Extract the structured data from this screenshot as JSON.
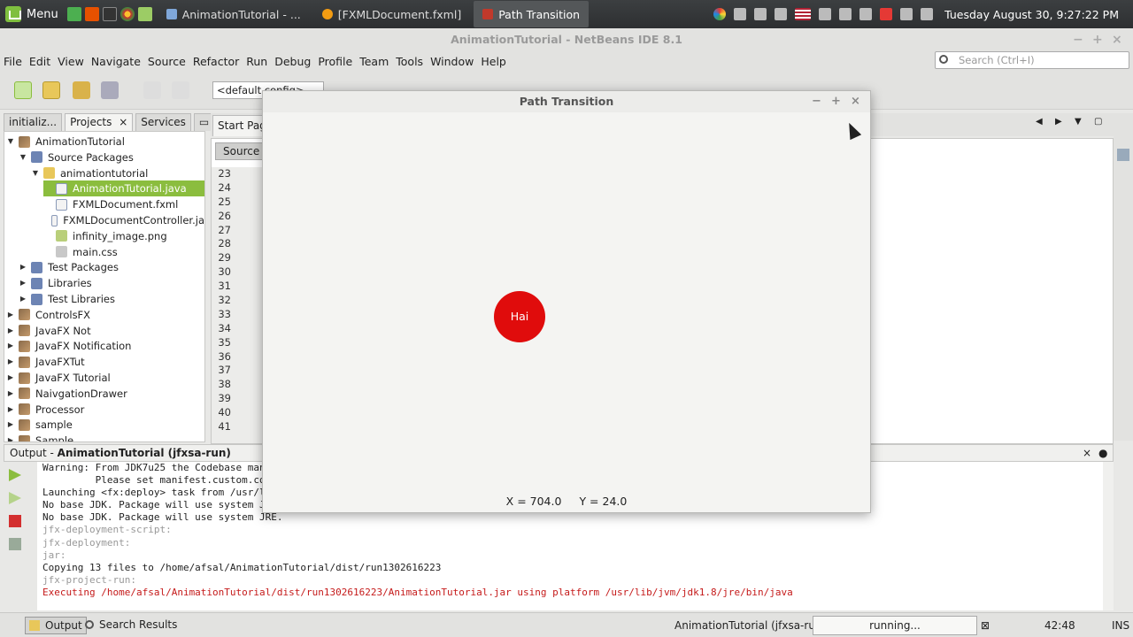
{
  "taskbar": {
    "menu_label": "Menu",
    "tasks": [
      {
        "label": "AnimationTutorial - ..."
      },
      {
        "label": "[FXMLDocument.fxml]"
      },
      {
        "label": "Path Transition"
      }
    ],
    "clock": "Tuesday August 30,  9:27:22 PM"
  },
  "ide": {
    "title": "AnimationTutorial - NetBeans IDE 8.1",
    "menu": [
      "File",
      "Edit",
      "View",
      "Navigate",
      "Source",
      "Refactor",
      "Run",
      "Debug",
      "Profile",
      "Team",
      "Tools",
      "Window",
      "Help"
    ],
    "search_placeholder": "Search (Ctrl+I)",
    "config": "<default config>"
  },
  "left_panel": {
    "tabs": [
      "initializ...",
      "Projects",
      "Services"
    ],
    "tree": [
      {
        "label": "AnimationTutorial",
        "depth": 0,
        "icon": "project-icon",
        "expanded": true
      },
      {
        "label": "Source Packages",
        "depth": 1,
        "icon": "package-icon",
        "expanded": true
      },
      {
        "label": "animationtutorial",
        "depth": 2,
        "icon": "folder-icon",
        "expanded": true
      },
      {
        "label": "AnimationTutorial.java",
        "depth": 3,
        "icon": "java-file-icon",
        "selected": true
      },
      {
        "label": "FXMLDocument.fxml",
        "depth": 3,
        "icon": "fxml-file-icon"
      },
      {
        "label": "FXMLDocumentController.ja",
        "depth": 3,
        "icon": "java-file-icon"
      },
      {
        "label": "infinity_image.png",
        "depth": 3,
        "icon": "image-file-icon"
      },
      {
        "label": "main.css",
        "depth": 3,
        "icon": "css-file-icon"
      },
      {
        "label": "Test Packages",
        "depth": 1,
        "icon": "package-icon"
      },
      {
        "label": "Libraries",
        "depth": 1,
        "icon": "package-icon"
      },
      {
        "label": "Test Libraries",
        "depth": 1,
        "icon": "package-icon"
      },
      {
        "label": "ControlsFX",
        "depth": 0,
        "icon": "project-icon"
      },
      {
        "label": "JavaFX Not",
        "depth": 0,
        "icon": "project-icon"
      },
      {
        "label": "JavaFX Notification",
        "depth": 0,
        "icon": "project-icon"
      },
      {
        "label": "JavaFXTut",
        "depth": 0,
        "icon": "project-icon"
      },
      {
        "label": "JavaFX Tutorial",
        "depth": 0,
        "icon": "project-icon"
      },
      {
        "label": "NaivgationDrawer",
        "depth": 0,
        "icon": "project-icon"
      },
      {
        "label": "Processor",
        "depth": 0,
        "icon": "project-icon"
      },
      {
        "label": "sample",
        "depth": 0,
        "icon": "project-icon"
      },
      {
        "label": "Sample",
        "depth": 0,
        "icon": "project-icon"
      }
    ]
  },
  "editor": {
    "tab": "Start Page",
    "source_tab": "Source",
    "line_numbers": [
      "23",
      "24",
      "25",
      "26",
      "27",
      "28",
      "29",
      "30",
      "31",
      "32",
      "33",
      "34",
      "35",
      "36",
      "37",
      "38",
      "39",
      "40",
      "41"
    ]
  },
  "output": {
    "header_prefix": "Output - ",
    "header_bold": "AnimationTutorial (jfxsa-run)",
    "lines": [
      {
        "text": "Warning: From JDK7u25 the Codebase man",
        "style": "normal"
      },
      {
        "text": "         Please set manifest.custom.co",
        "style": "normal"
      },
      {
        "text": "Launching <fx:deploy> task from /usr/l",
        "style": "normal"
      },
      {
        "text": "No base JDK. Package will use system J",
        "style": "normal"
      },
      {
        "text": "No base JDK. Package will use system JRE.",
        "style": "normal"
      },
      {
        "text": "jfx-deployment-script:",
        "style": "gray"
      },
      {
        "text": "jfx-deployment:",
        "style": "gray"
      },
      {
        "text": "jar:",
        "style": "gray"
      },
      {
        "text": "Copying 13 files to /home/afsal/AnimationTutorial/dist/run1302616223",
        "style": "normal"
      },
      {
        "text": "jfx-project-run:",
        "style": "gray"
      },
      {
        "text": "Executing /home/afsal/AnimationTutorial/dist/run1302616223/AnimationTutorial.jar using platform /usr/lib/jvm/jdk1.8/jre/bin/java",
        "style": "red"
      }
    ]
  },
  "statusbar": {
    "output_tab": "Output",
    "search_results": "Search Results",
    "task": "AnimationTutorial (jfxsa-run)",
    "progress": "running...",
    "time": "42:48",
    "mode": "INS"
  },
  "path_window": {
    "title": "Path Transition",
    "circle_label": "Hai",
    "circle_color": "#e00c0c",
    "x_readout": "X = 704.0",
    "y_readout": "Y = 24.0"
  }
}
